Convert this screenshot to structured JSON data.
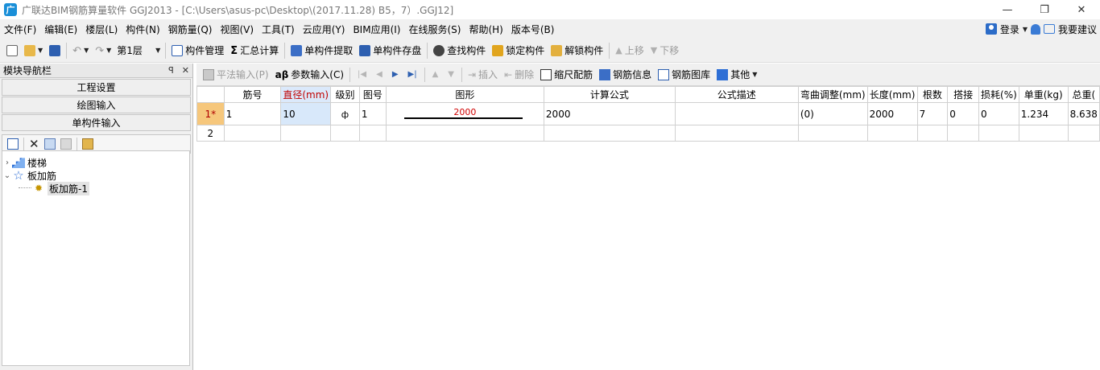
{
  "window": {
    "title": "广联达BIM钢筋算量软件 GGJ2013 - [C:\\Users\\asus-pc\\Desktop\\(2017.11.28) B5，7）.GGJ12]",
    "app_icon_glyph": "广",
    "min_glyph": "—",
    "max_glyph": "❐",
    "close_glyph": "✕"
  },
  "menu": {
    "items": [
      "文件(F)",
      "编辑(E)",
      "楼层(L)",
      "构件(N)",
      "钢筋量(Q)",
      "视图(V)",
      "工具(T)",
      "云应用(Y)",
      "BIM应用(I)",
      "在线服务(S)",
      "帮助(H)",
      "版本号(B)"
    ],
    "login": "登录",
    "suggest": "我要建议"
  },
  "toolbar": {
    "floor": "第1层",
    "component_manage": "构件管理",
    "sum_calc": "汇总计算",
    "single_extract": "单构件提取",
    "single_store": "单构件存盘",
    "find_component": "查找构件",
    "lock_component": "锁定构件",
    "unlock_component": "解锁构件",
    "move_up": "上移",
    "move_down": "下移"
  },
  "nav": {
    "header": "模块导航栏",
    "pin_glyph": "ꟼ",
    "close_glyph": "✕",
    "buttons": [
      "工程设置",
      "绘图输入",
      "单构件输入"
    ],
    "tree": {
      "node1": "楼梯",
      "node2": "板加筋",
      "leaf": "板加筋-1"
    }
  },
  "grid_toolbar": {
    "flat_input": "平法输入(P)",
    "param_input": "参数输入(C)",
    "insert": "插入",
    "delete": "删除",
    "scale_rebar": "缩尺配筋",
    "rebar_info": "钢筋信息",
    "rebar_lib": "钢筋图库",
    "other": "其他"
  },
  "grid": {
    "columns": [
      "",
      "筋号",
      "直径(mm)",
      "级别",
      "图号",
      "图形",
      "计算公式",
      "公式描述",
      "弯曲调整(mm)",
      "长度(mm)",
      "根数",
      "搭接",
      "损耗(%)",
      "单重(kg)",
      "总重("
    ],
    "rows": [
      {
        "rownum": "1*",
        "bar_no": "1",
        "diameter": "10",
        "grade": "ф",
        "fig_no": "1",
        "shape_value": "2000",
        "formula": "2000",
        "formula_desc": "",
        "bend_adjust": "(0)",
        "length": "2000",
        "count": "7",
        "lap": "0",
        "loss": "0",
        "unit_weight": "1.234",
        "total_weight": "8.638"
      },
      {
        "rownum": "2"
      }
    ]
  }
}
